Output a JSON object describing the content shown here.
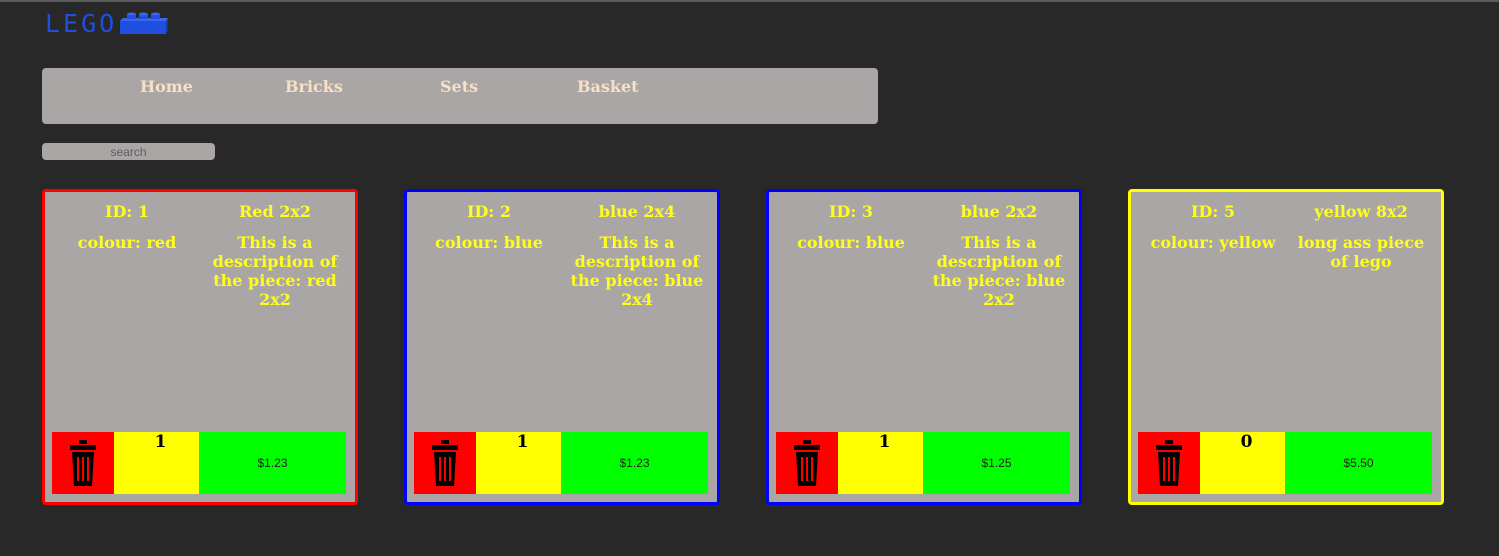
{
  "logo": {
    "text": "LEGO",
    "brick_color": "#1f4fe0"
  },
  "nav": {
    "items": [
      "Home",
      "Bricks",
      "Sets",
      "Basket"
    ],
    "text_color": "#f7e1c6"
  },
  "search": {
    "placeholder": "search",
    "value": ""
  },
  "cards": [
    {
      "id_label": "ID: 1",
      "name": "Red 2x2",
      "colour_label": "colour: red",
      "description": "This is a description of the piece: red 2x2",
      "quantity": "1",
      "price": "$1.23",
      "border_color": "#ff0000"
    },
    {
      "id_label": "ID: 2",
      "name": "blue 2x4",
      "colour_label": "colour: blue",
      "description": "This is a description of the piece: blue 2x4",
      "quantity": "1",
      "price": "$1.23",
      "border_color": "#0000ff"
    },
    {
      "id_label": "ID: 3",
      "name": "blue 2x2",
      "colour_label": "colour: blue",
      "description": "This is a description of the piece: blue 2x2",
      "quantity": "1",
      "price": "$1.25",
      "border_color": "#0000ff"
    },
    {
      "id_label": "ID: 5",
      "name": "yellow 8x2",
      "colour_label": "colour: yellow",
      "description": "long ass piece of lego",
      "quantity": "0",
      "price": "$5.50",
      "border_color": "#ffff00"
    }
  ],
  "colors": {
    "trash": "#ff0000",
    "quantity": "#ffff00",
    "price": "#00ff00",
    "card_text": "#ffff1a"
  },
  "icons": {
    "logo_brick": "lego-brick-icon",
    "trash": "trash-icon"
  }
}
